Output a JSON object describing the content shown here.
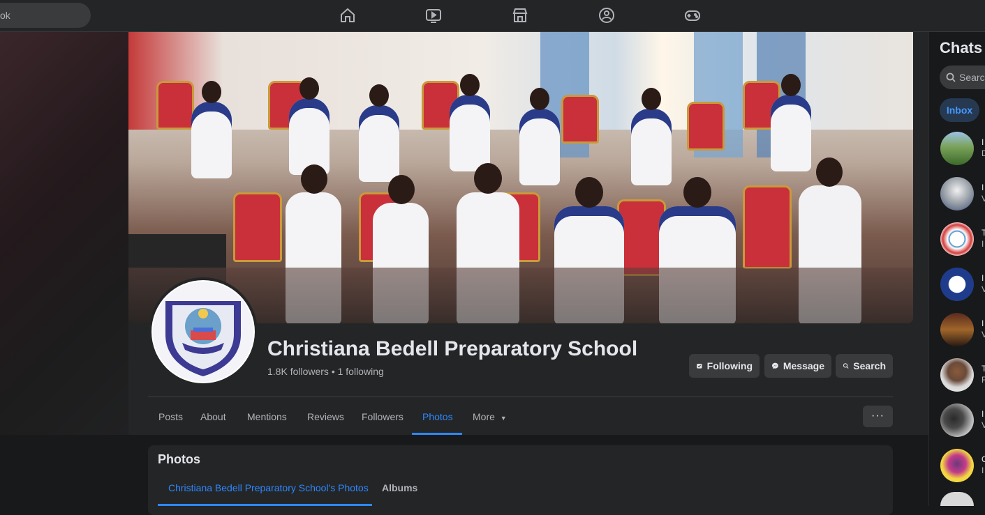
{
  "topbar": {
    "search_text": "ok",
    "nav_icons": [
      "home-icon",
      "video-icon",
      "marketplace-icon",
      "groups-icon",
      "gaming-icon"
    ]
  },
  "page": {
    "name": "Christiana Bedell Preparatory School",
    "stats": "1.8K followers • 1 following",
    "avatar_text": {
      "arc": "CHRISTIANA BEDELL",
      "ribbon": "PREPARATORY SCHOOL",
      "address": "NEW GEORGIA HOUSING ESTATE",
      "founded": "FOUNDED APRIL 3, 1995",
      "motto": "INVEST YOUR FUTURE THROUGH QUALITY EDUCATION"
    }
  },
  "actions": {
    "following": "Following",
    "message": "Message",
    "search": "Search"
  },
  "tabs": [
    {
      "label": "Posts"
    },
    {
      "label": "About"
    },
    {
      "label": "Mentions"
    },
    {
      "label": "Reviews"
    },
    {
      "label": "Followers"
    },
    {
      "label": "Photos"
    },
    {
      "label": "More"
    }
  ],
  "more_dots": "···",
  "photos": {
    "title": "Photos",
    "tab_owner": "Christiana Bedell Preparatory School's Photos",
    "tab_albums": "Albums"
  },
  "chats": {
    "title": "Chats",
    "search_placeholder": "Search",
    "inbox": "Inbox",
    "items": [
      {
        "l1": "I",
        "l2": "D"
      },
      {
        "l1": "I",
        "l2": "V"
      },
      {
        "l1": "T",
        "l2": "I"
      },
      {
        "l1": "I",
        "l2": "V"
      },
      {
        "l1": "I",
        "l2": "V"
      },
      {
        "l1": "T",
        "l2": "F"
      },
      {
        "l1": "I",
        "l2": "V"
      },
      {
        "l1": "C",
        "l2": "I"
      }
    ]
  },
  "colors": {
    "accent": "#2d88ff",
    "surface": "#242526",
    "button": "#3a3b3c",
    "background": "#18191a"
  }
}
